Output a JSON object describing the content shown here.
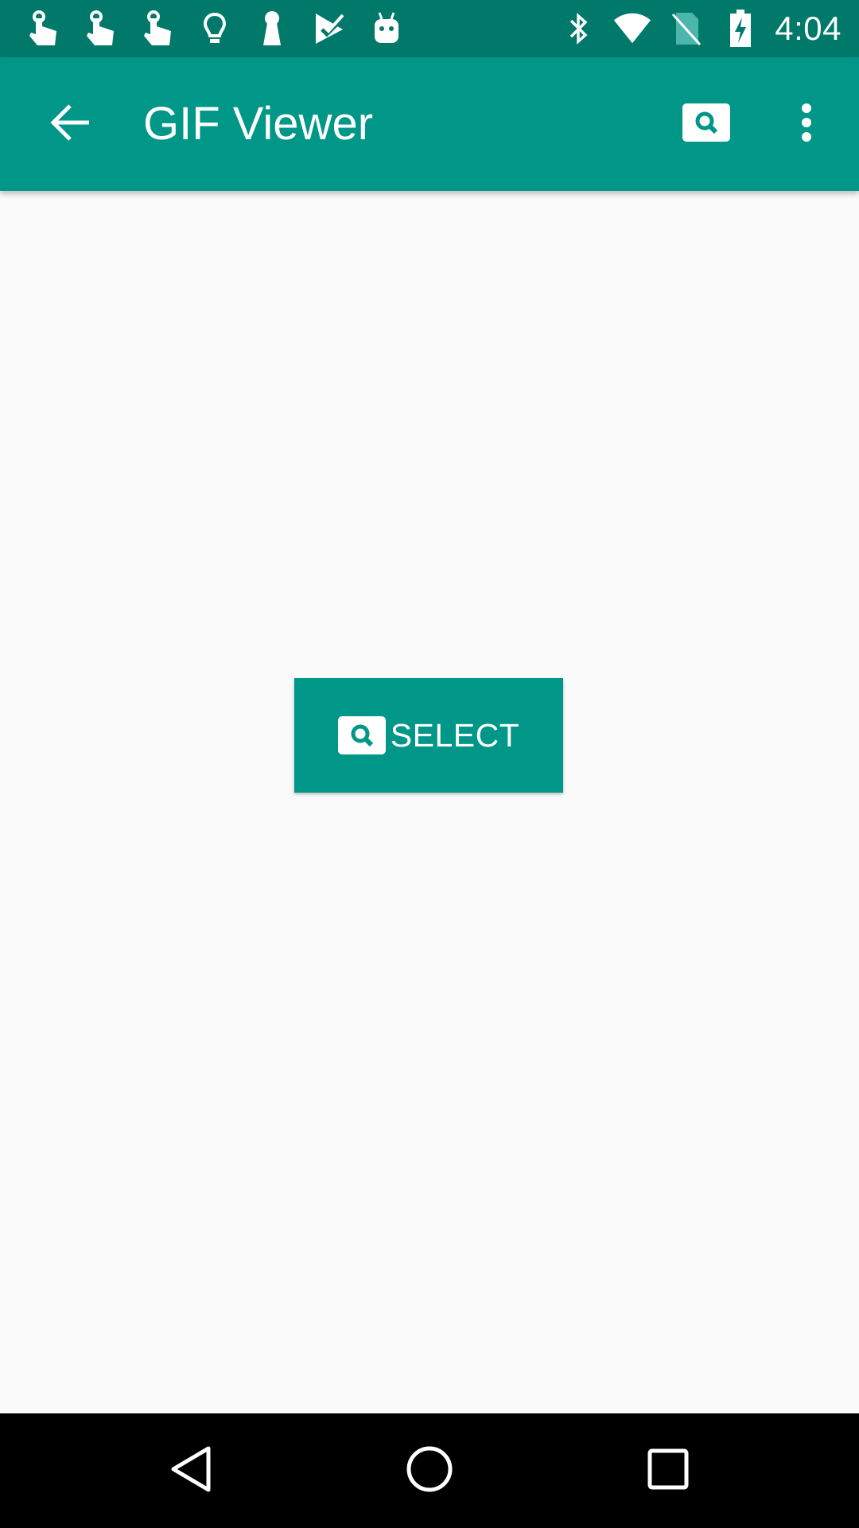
{
  "status_bar": {
    "time": "4:04",
    "left_icons": [
      "touch-app-icon",
      "touch-app-icon",
      "touch-app-icon",
      "lightbulb-icon",
      "keyhole-icon",
      "play-store-check-icon",
      "android-icon"
    ],
    "right_icons": [
      "bluetooth-icon",
      "wifi-icon",
      "no-sim-icon",
      "battery-charging-icon"
    ]
  },
  "app_bar": {
    "title": "GIF Viewer",
    "back_icon": "arrow-back-icon",
    "search_icon": "image-search-icon",
    "overflow_icon": "more-vert-icon"
  },
  "main": {
    "select_button": {
      "label": "SELECT",
      "icon": "image-search-icon"
    }
  },
  "nav_bar": {
    "icons": [
      "back-triangle-icon",
      "home-circle-icon",
      "recents-square-icon"
    ]
  },
  "colors": {
    "status_bar": "#00796b",
    "app_bar": "#009688",
    "accent": "#009688",
    "background": "#fafafa",
    "nav_bar": "#000000",
    "on_primary": "#ffffff"
  }
}
